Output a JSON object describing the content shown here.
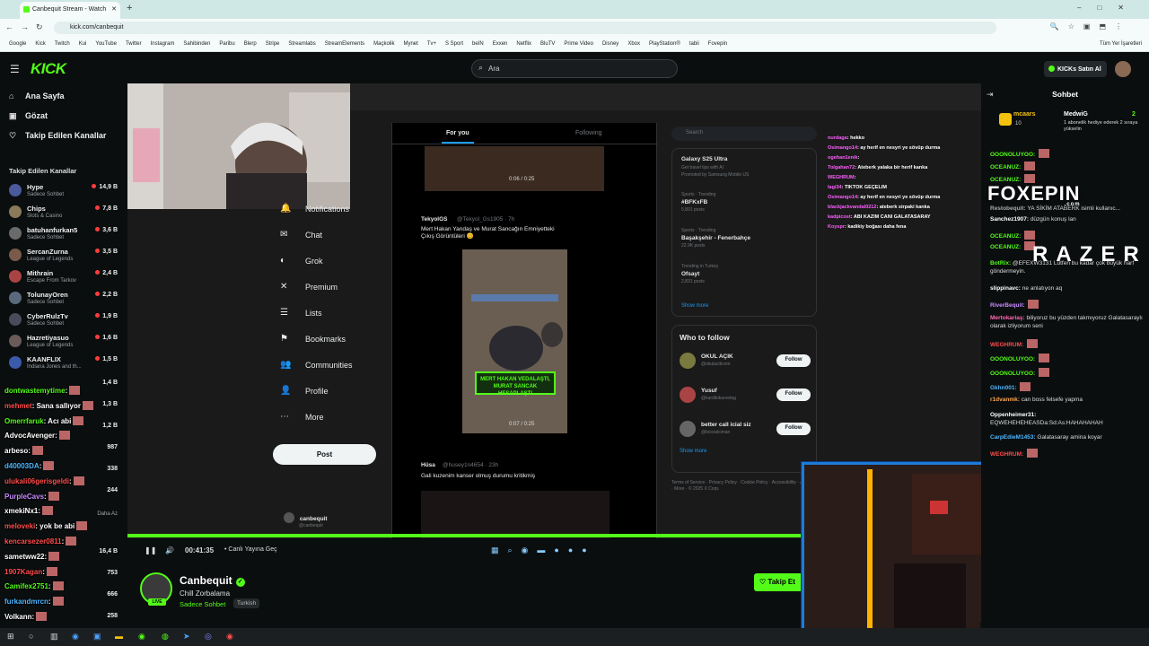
{
  "browser": {
    "tab_title": "Canbequit Stream - Watch",
    "new_tab": "+",
    "url": "kick.com/canbequit",
    "bookmarks": [
      "Google",
      "Kick",
      "Twitch",
      "Kui",
      "YouTube",
      "Twitter",
      "Instagram",
      "Sahibinden",
      "Paribu",
      "Blerp",
      "Stripe",
      "Streamlabs",
      "StreamElements",
      "Maçkolik",
      "Mynet",
      "Tv+",
      "S Sport",
      "beIN",
      "Exxen",
      "Netflix",
      "BluTV",
      "Prime Video",
      "Disney",
      "Xbox",
      "PlayStation®",
      "tabii",
      "Fovepin"
    ],
    "bookmarks_right": "Tüm Yer İşaretleri"
  },
  "header": {
    "logo": "KICK",
    "search_placeholder": "Ara",
    "buy_kicks": "KICKs Satın Al"
  },
  "sidebar": {
    "nav": [
      {
        "label": "Ana Sayfa",
        "icon": "home-icon",
        "glyph": "⌂"
      },
      {
        "label": "Gözat",
        "icon": "browse-icon",
        "glyph": "▣"
      },
      {
        "label": "Takip Edilen Kanallar",
        "icon": "heart-icon",
        "glyph": "♡"
      }
    ],
    "section_title": "Takip Edilen Kanallar",
    "channels": [
      {
        "name": "Hype",
        "category": "Sadece Sohbet",
        "viewers": "14,9 B",
        "color": "#4a5a9a"
      },
      {
        "name": "Chips",
        "category": "Slots & Casino",
        "viewers": "7,8 B",
        "color": "#8a7a5a"
      },
      {
        "name": "batuhanfurkan5",
        "category": "Sadece Sohbet",
        "viewers": "3,6 B",
        "color": "#6a6a6a"
      },
      {
        "name": "SercanZurna",
        "category": "League of Legends",
        "viewers": "3,5 B",
        "color": "#7a5a4a"
      },
      {
        "name": "Mithrain",
        "category": "Escape From Tarkov",
        "viewers": "2,4 B",
        "color": "#aa4444"
      },
      {
        "name": "TolunayOren",
        "category": "Sadece Sohbet",
        "viewers": "2,2 B",
        "color": "#5a6a7a"
      },
      {
        "name": "CyberRulzTv",
        "category": "Sadece Sohbet",
        "viewers": "1,9 B",
        "color": "#4a4a5a"
      },
      {
        "name": "Hazretiyasuo",
        "category": "League of Legends",
        "viewers": "1,6 B",
        "color": "#6a5a5a"
      },
      {
        "name": "KAANFLIX",
        "category": "Indiana Jones and th...",
        "viewers": "1,5 B",
        "color": "#3a5aaa"
      }
    ],
    "more_viewers": [
      "1,4 B",
      "1,3 B",
      "1,2 B",
      "987",
      "338",
      "244",
      "16,4 B",
      "753",
      "666",
      "258"
    ],
    "more_label": "Daha Az"
  },
  "overlay_chat": [
    {
      "user": "dontwastemytime",
      "text": "",
      "cls": "b"
    },
    {
      "user": "mehmet",
      "text": "Sana sallıyor",
      "cls": "em"
    },
    {
      "user": "Omerrfaruk",
      "text": "Acı abi",
      "cls": "b"
    },
    {
      "user": "AdvocAvenger",
      "text": "",
      "cls": "plain"
    },
    {
      "user": "arbeso",
      "text": "",
      "cls": "plain"
    },
    {
      "user": "d40003DA",
      "text": "",
      "cls": "s"
    },
    {
      "user": "ulukali06gerisgeldi",
      "text": "",
      "cls": "em"
    },
    {
      "user": "PurpleCavs",
      "text": "",
      "cls": "u"
    },
    {
      "user": "xmekiNx1",
      "text": "",
      "cls": "plain"
    },
    {
      "user": "meloveki",
      "text": "yok be abi",
      "cls": "em"
    },
    {
      "user": "kencarsezer0811",
      "text": "",
      "cls": "em"
    },
    {
      "user": "sametww22",
      "text": "",
      "cls": "plain"
    },
    {
      "user": "1907Kagan",
      "text": "",
      "cls": "em"
    },
    {
      "user": "Camifex2751",
      "text": "",
      "cls": "b"
    },
    {
      "user": "furkandmrcn",
      "text": "",
      "cls": "s"
    },
    {
      "user": "Volkann",
      "text": "",
      "cls": "plain"
    }
  ],
  "x_nav": [
    {
      "label": "Notifications",
      "icon": "bell-icon",
      "glyph": "🔔"
    },
    {
      "label": "Chat",
      "icon": "mail-icon",
      "glyph": "✉"
    },
    {
      "label": "Grok",
      "icon": "grok-icon",
      "glyph": "◐"
    },
    {
      "label": "Premium",
      "icon": "x-logo-icon",
      "glyph": "✕"
    },
    {
      "label": "Lists",
      "icon": "list-icon",
      "glyph": "☰"
    },
    {
      "label": "Bookmarks",
      "icon": "bookmark-icon",
      "glyph": "⚑"
    },
    {
      "label": "Communities",
      "icon": "people-icon",
      "glyph": "👥"
    },
    {
      "label": "Profile",
      "icon": "person-icon",
      "glyph": "👤"
    },
    {
      "label": "More",
      "icon": "more-icon",
      "glyph": "⋯"
    }
  ],
  "x_post_label": "Post",
  "x_user": {
    "name": "canbequit",
    "handle": "@canbequit"
  },
  "feed": {
    "tabs": [
      "For you",
      "Following"
    ],
    "tweet1": {
      "user": "TekyolGS",
      "handle": "@Tekyol_Gs1905 · 7h",
      "text": "Mert Hakan Yandaş ve Murat Sancağın Emniyetteki Çıkış Görüntüleri 😊",
      "caption": "MERT HAKAN VEDALAŞTI, MURAT SANCAK HESAPLAŞTI",
      "time1": "0:06 / 0:25",
      "time2": "0:07 / 0:25"
    },
    "tweet2": {
      "user": "Hüsa",
      "handle": "@husey1n4654 · 23h",
      "text": "Gali kuzenim kanser olmuş durumu kritikmiş"
    }
  },
  "x_right": {
    "search": "Search",
    "promo": {
      "title": "Galaxy S25 Ultra",
      "sub": "Get travel tips with AI",
      "ad": "Promoted by Samsung Mobile US"
    },
    "trends": [
      {
        "meta": "Sports · Trending",
        "name": "#BFKxFB",
        "count": "5,801 posts"
      },
      {
        "meta": "Sports · Trending",
        "name": "Başakşehir - Fenerbahçe",
        "count": "22.9K posts"
      },
      {
        "meta": "Trending in Turkey",
        "name": "Ofsayt",
        "count": "2,831 posts"
      }
    ],
    "show_more": "Show more",
    "who_title": "Who to follow",
    "who": [
      {
        "name": "OKUL AÇIK",
        "handle": "@okulacikcom",
        "color": "#7a7a40"
      },
      {
        "name": "Yusuf",
        "handle": "@kardilokarvetag",
        "color": "#aa4444"
      },
      {
        "name": "better call icial siz",
        "handle": "@bcicialciman",
        "color": "#666666"
      }
    ],
    "follow": "Follow",
    "footer": "Terms of Service · Privacy Policy · Cookie Policy · Accessibility · Ads info · More · © 2025 X Corp."
  },
  "stream_overlay_chat": [
    {
      "user": "nurdaga",
      "text": "hekko"
    },
    {
      "user": "Osimango14",
      "text": "ay herif en nesyri ye sövüp durma"
    },
    {
      "user": "ogehan1enik",
      "text": ""
    },
    {
      "user": "Tolgahan72",
      "text": "Ateberk yalaka bir herif kanka"
    },
    {
      "user": "WEGHRUM",
      "text": ""
    },
    {
      "user": "lagi34",
      "text": "TIKTOK GEÇELİM"
    },
    {
      "user": "Osimango14",
      "text": "ay herif en nesyri ye sövüp durma"
    },
    {
      "user": "blackjackvandal0212",
      "text": "ateberk sirpaki kanka"
    },
    {
      "user": "kadpicost",
      "text": "ABİ KAZIM CANİ GALATASARAY"
    },
    {
      "user": "Koyspr",
      "text": "kadikiy boğası daha fena"
    }
  ],
  "controls": {
    "time": "00:41:35",
    "go_live": "Canlı Yayına Geç"
  },
  "streamer": {
    "name": "Canbequit",
    "title": "Chill Zorbalama",
    "category": "Sadece Sohbet",
    "language": "Turkish",
    "live": "LIVE",
    "follow": "Takip Et"
  },
  "chat": {
    "title": "Sohbet",
    "top_gifter": {
      "name": "mcaars",
      "count": "10",
      "recent": "MedwiG",
      "recent_text": "1 abonelik hediye ederek 2 sıraya yükselin",
      "rank": "2"
    },
    "messages": [
      {
        "user": "OOONOLUYOO:",
        "text": "",
        "color": "#53fc18"
      },
      {
        "user": "OCEANUZ:",
        "text": "",
        "color": "#53fc18"
      },
      {
        "user": "OCEANUZ:",
        "text": "",
        "color": "#53fc18"
      },
      {
        "user": "Restobequit:",
        "text": "YA SİKİM ATABERK isimli kullanıc...",
        "color": "#aaaaaa"
      },
      {
        "user": "Sanchez1907:",
        "text": "düzgün konuş lan",
        "color": "#ffffff"
      },
      {
        "user": "OCEANUZ:",
        "text": "",
        "color": "#53fc18"
      },
      {
        "user": "OCEANUZ:",
        "text": "",
        "color": "#53fc18"
      },
      {
        "user": "BotRix:",
        "text": "@EFEXW3131 Lütfen bu kadar çok büyük harf göndermeyin.",
        "color": "#53fc18"
      },
      {
        "user": "slippinavc:",
        "text": "ne anlatıyon aq",
        "color": "#ffffff"
      },
      {
        "user": "RiverBequit:",
        "text": "",
        "color": "#c88cff"
      },
      {
        "user": "Mertokariaş:",
        "text": "biliyoruz bu yüzden takmıyoruz Galatasaraylı olarak izliyorum seni",
        "color": "#ff69b4"
      },
      {
        "user": "WEGHRUM:",
        "text": "",
        "color": "#ff4d4d"
      },
      {
        "user": "OOONOLUYOO:",
        "text": "",
        "color": "#53fc18"
      },
      {
        "user": "OOONOLUYOO:",
        "text": "",
        "color": "#53fc18"
      },
      {
        "user": "Gkhn001:",
        "text": "",
        "color": "#4db6ff"
      },
      {
        "user": "r1dvanmk:",
        "text": "can boss felsefe yapma",
        "color": "#ffa64d"
      },
      {
        "user": "Oppenheimer31:",
        "text": "EQWEHEHEHEASDa:Sd:As:HAHAHAHAH",
        "color": "#ffffff"
      },
      {
        "user": "CarpEdieM1453:",
        "text": "Galatasaray amina koyar",
        "color": "#4db6ff"
      },
      {
        "user": "WEGHRUM:",
        "text": "",
        "color": "#ff4d4d"
      }
    ]
  },
  "sponsors": {
    "foxepin": "FOXEPIN",
    "foxepin_sub": ".com",
    "razer": "RAZER"
  },
  "colors": {
    "kick_green": "#53fc18",
    "bg": "#0b0e0f",
    "facecam_border": "#1e7bd8"
  }
}
